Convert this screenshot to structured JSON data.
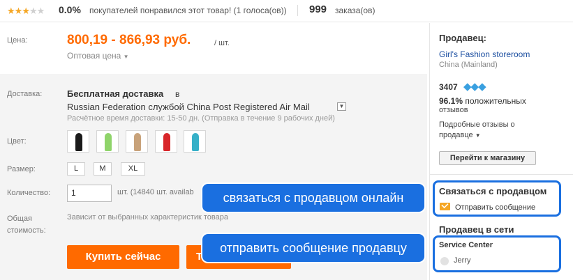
{
  "rating": {
    "stars_filled": 3,
    "stars_total": 5,
    "percent": "0.0%",
    "liked_text": "покупателей понравился этот товар! (1 голоса(ов))",
    "orders_count": "999",
    "orders_label": "заказа(ов)"
  },
  "price": {
    "label": "Цена:",
    "value": "800,19 - 866,93 руб.",
    "per_unit": "/ шт.",
    "wholesale": "Оптовая цена"
  },
  "shipping": {
    "label": "Доставка:",
    "title": "Бесплатная доставка",
    "in_word": "в",
    "line": "Russian Federation службой China Post Registered Air Mail",
    "time": "Расчётное время доставки: 15-50 дн. (Отправка в течение 9 рабочих дней)"
  },
  "color": {
    "label": "Цвет:",
    "swatches": [
      "#1a1a1a",
      "#8fd46a",
      "#c8a27a",
      "#d8262a",
      "#36b0c8"
    ]
  },
  "size": {
    "label": "Размер:",
    "options": [
      "L",
      "M",
      "XL"
    ]
  },
  "quantity": {
    "label": "Количество:",
    "value": "1",
    "note": "шт. (14840 шт. availab"
  },
  "total": {
    "label_line1": "Общая",
    "label_line2": "стоимость:",
    "note": "Зависит от выбранных характеристик товара"
  },
  "actions": {
    "buy_now": "Купить сейчас",
    "cart_partial": "Т"
  },
  "seller": {
    "heading": "Продавец:",
    "name": "Girl's Fashion storeroom",
    "location": "China (Mainland)",
    "score": "3407",
    "feedback_pct": "96.1%",
    "feedback_rest_1": "положительных",
    "feedback_rest_2": "отзывов",
    "detailed_1": "Подробные отзывы о",
    "detailed_2": "продавце",
    "goto_store": "Перейти к магазину"
  },
  "contact": {
    "heading": "Связаться с продавцом",
    "send_message": "Отправить сообщение"
  },
  "online": {
    "heading": "Продавец в сети",
    "service": "Service Center",
    "agent": "Jerry"
  },
  "callouts": {
    "first": "связаться с продавцом онлайн",
    "second": "отправить сообщение продавцу"
  },
  "colors": {
    "accent": "#ff6a00",
    "highlight": "#1a6fe0",
    "link": "#1b4ea0"
  }
}
